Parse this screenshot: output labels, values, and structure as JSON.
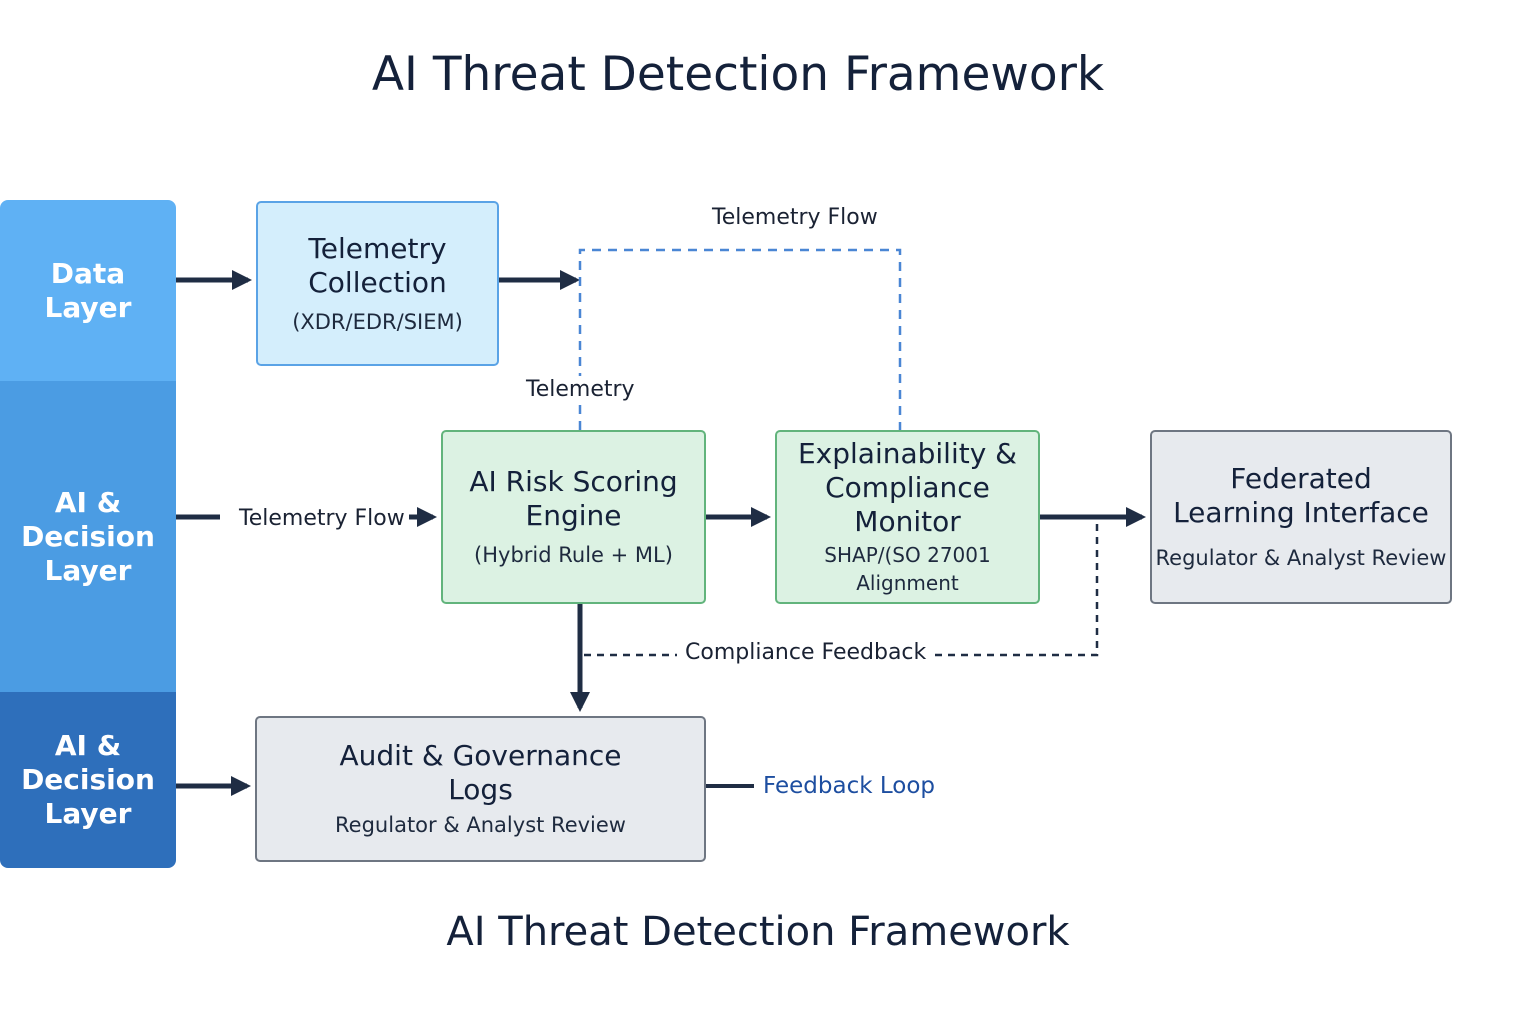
{
  "title": "AI Threat Detection Framework",
  "footer_title": "AI Threat Detection Framework",
  "lanes": [
    {
      "label": "Data\nLayer"
    },
    {
      "label": "AI &\nDecision\nLayer"
    },
    {
      "label": "AI &\nDecision\nLayer"
    }
  ],
  "boxes": {
    "telemetry": {
      "title": "Telemetry\nCollection",
      "subtitle": "(XDR/EDR/SIEM)"
    },
    "risk": {
      "title": "AI Risk Scoring\nEngine",
      "subtitle": "(Hybrid Rule + ML)"
    },
    "explain": {
      "title": "Explainability &\nCompliance\nMonitor",
      "subtitle": "SHAP/(SO 27001 Alignment"
    },
    "federated": {
      "title": "Federated\nLearning Interface",
      "subtitle": "Regulator & Analyst Review"
    },
    "audit": {
      "title": "Audit & Governance\nLogs",
      "subtitle": "Regulator & Analyst Review"
    }
  },
  "labels": {
    "telemetry_flow_top": "Telemetry Flow",
    "telemetry": "Telemetry",
    "telemetry_flow_left": "Telemetry Flow",
    "compliance_feedback": "Compliance Feedback",
    "feedback_loop": "Feedback Loop"
  },
  "colors": {
    "lane_data": "#5fb1f4",
    "lane_ai": "#4b9ce3",
    "lane_audit": "#2e6fbb",
    "arrow": "#1f2d44",
    "dashed_blue": "#4a86d4"
  }
}
